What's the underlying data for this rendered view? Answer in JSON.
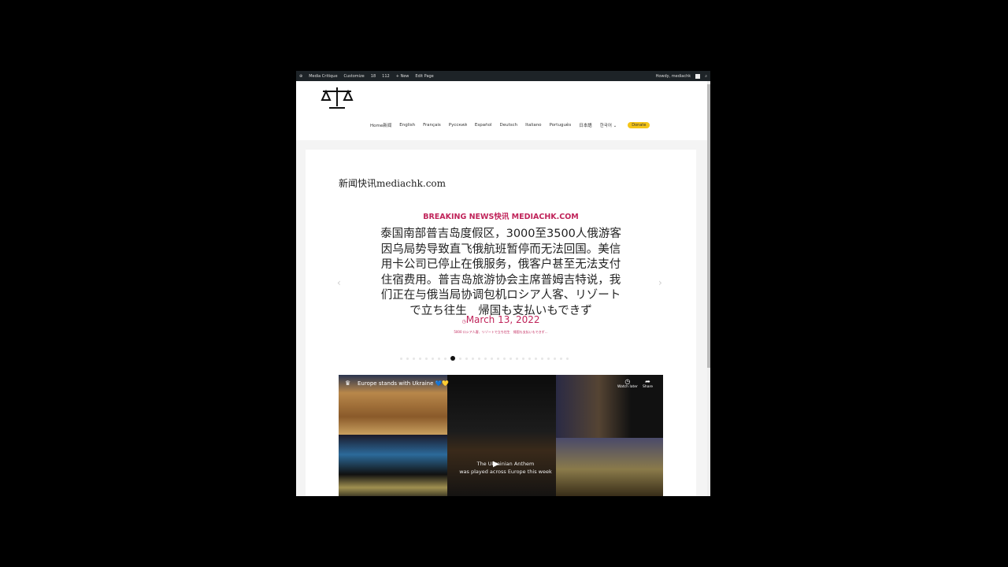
{
  "admin_bar": {
    "items": [
      "Media Critique",
      "Customize",
      "18",
      "112",
      "+ New",
      "Edit Page"
    ],
    "greeting": "Howdy, mediachk"
  },
  "nav": {
    "items": [
      "Home新闻",
      "English",
      "Français",
      "Русский",
      "Español",
      "Deutsch",
      "Italiano",
      "Português",
      "日本語",
      "한국어 ⌄"
    ],
    "donate": "Donate"
  },
  "site_title": "新闻快讯mediachk.com",
  "post": {
    "kicker": "BREAKING NEWS快讯 MEDIACHK.COM",
    "body": "泰国南部普吉岛度假区，3000至3500人俄游客因乌局势导致直飞俄航班暂停而无法回国。美信用卡公司已停止在俄服务，俄客户甚至无法支付住宿费用。普吉岛旅游协会主席普姆吉特说，我们正在与俄当局协调包机ロシア人客、リゾートで立ち往生　帰国も支払いもできず",
    "date": "March 13, 2022",
    "tags": "5000 ロシア人客、リゾートで立ち往生　帰国も支払いもできず…"
  },
  "video": {
    "title": "Europe stands with Ukraine 💙💛",
    "watch_later": "Watch later",
    "share": "Share",
    "caption1": "The Ukrainian Anthem",
    "caption2": "was played across Europe this week"
  },
  "colors": {
    "accent": "#c0245a",
    "donate": "#f5c518"
  }
}
